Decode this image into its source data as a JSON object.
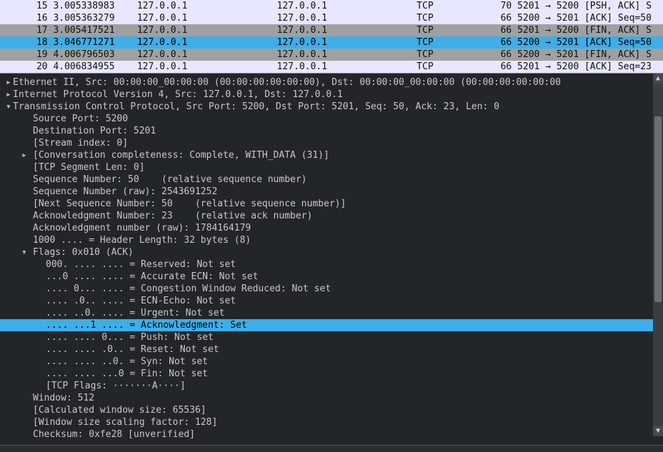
{
  "packet_list": [
    {
      "no": "15",
      "time": "3.005338983",
      "src": "127.0.0.1",
      "dst": "127.0.0.1",
      "proto": "TCP",
      "len": "70",
      "info": "5201 → 5200 [PSH, ACK] S",
      "row_class": ""
    },
    {
      "no": "16",
      "time": "3.005363279",
      "src": "127.0.0.1",
      "dst": "127.0.0.1",
      "proto": "TCP",
      "len": "66",
      "info": "5200 → 5201 [ACK] Seq=50",
      "row_class": ""
    },
    {
      "no": "17",
      "time": "3.005417521",
      "src": "127.0.0.1",
      "dst": "127.0.0.1",
      "proto": "TCP",
      "len": "66",
      "info": "5201 → 5200 [FIN, ACK] S",
      "row_class": "grey packet-mark"
    },
    {
      "no": "18",
      "time": "3.046771271",
      "src": "127.0.0.1",
      "dst": "127.0.0.1",
      "proto": "TCP",
      "len": "66",
      "info": "5200 → 5201 [ACK] Seq=50",
      "row_class": "selected"
    },
    {
      "no": "19",
      "time": "4.006796503",
      "src": "127.0.0.1",
      "dst": "127.0.0.1",
      "proto": "TCP",
      "len": "66",
      "info": "5200 → 5201 [FIN, ACK] S",
      "row_class": "grey"
    },
    {
      "no": "20",
      "time": "4.006834955",
      "src": "127.0.0.1",
      "dst": "127.0.0.1",
      "proto": "TCP",
      "len": "66",
      "info": "5201 → 5200 [ACK] Seq=23",
      "row_class": ""
    }
  ],
  "details": {
    "eth": "Ethernet II, Src: 00:00:00_00:00:00 (00:00:00:00:00:00), Dst: 00:00:00_00:00:00 (00:00:00:00:00:00",
    "ip": "Internet Protocol Version 4, Src: 127.0.0.1, Dst: 127.0.0.1",
    "tcp": "Transmission Control Protocol, Src Port: 5200, Dst Port: 5201, Seq: 50, Ack: 23, Len: 0",
    "src_port": "Source Port: 5200",
    "dst_port": "Destination Port: 5201",
    "stream": "[Stream index: 0]",
    "conv": "[Conversation completeness: Complete, WITH_DATA (31)]",
    "seglen": "[TCP Segment Len: 0]",
    "seq": "Sequence Number: 50    (relative sequence number)",
    "seq_raw": "Sequence Number (raw): 2543691252",
    "nseq": "[Next Sequence Number: 50    (relative sequence number)]",
    "ack": "Acknowledgment Number: 23    (relative ack number)",
    "ack_raw": "Acknowledgment number (raw): 1784164179",
    "hlen": "1000 .... = Header Length: 32 bytes (8)",
    "flags": "Flags: 0x010 (ACK)",
    "f_res": "000. .... .... = Reserved: Not set",
    "f_aecn": "...0 .... .... = Accurate ECN: Not set",
    "f_cwr": ".... 0... .... = Congestion Window Reduced: Not set",
    "f_ece": ".... .0.. .... = ECN-Echo: Not set",
    "f_urg": ".... ..0. .... = Urgent: Not set",
    "f_ack": ".... ...1 .... = Acknowledgment: Set",
    "f_psh": ".... .... 0... = Push: Not set",
    "f_rst": ".... .... .0.. = Reset: Not set",
    "f_syn": ".... .... ..0. = Syn: Not set",
    "f_fin": ".... .... ...0 = Fin: Not set",
    "f_str": "[TCP Flags: ·······A····]",
    "window": "Window: 512",
    "cws": "[Calculated window size: 65536]",
    "wssf": "[Window size scaling factor: 128]",
    "cksum": "Checksum: 0xfe28 [unverified]"
  }
}
